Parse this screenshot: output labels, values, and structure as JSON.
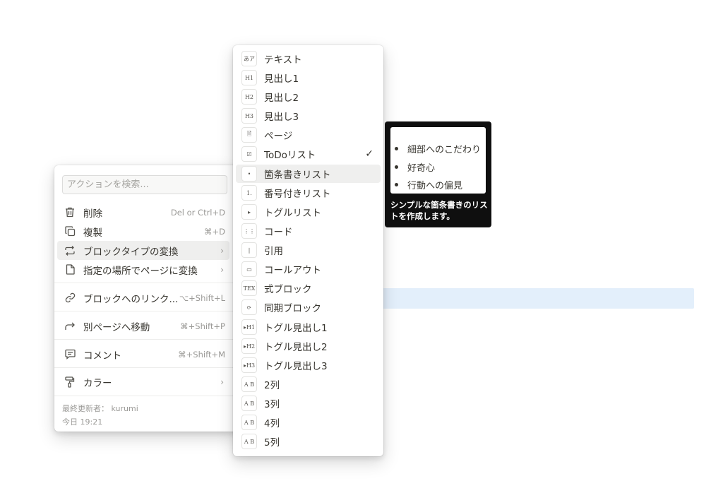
{
  "action_menu": {
    "search_placeholder": "アクションを検索...",
    "items": [
      {
        "label": "削除",
        "shortcut": "Del or Ctrl+D",
        "icon": "trash-icon"
      },
      {
        "label": "複製",
        "shortcut": "⌘+D",
        "icon": "duplicate-icon"
      },
      {
        "label": "ブロックタイプの変換",
        "shortcut": "",
        "icon": "convert-icon",
        "chevron": "›"
      },
      {
        "label": "指定の場所でページに変換",
        "shortcut": "",
        "icon": "page-icon",
        "chevron": "›"
      },
      {
        "label": "ブロックへのリンク...",
        "shortcut": "⌥+Shift+L",
        "icon": "link-icon"
      },
      {
        "label": "別ページへ移動",
        "shortcut": "⌘+Shift+P",
        "icon": "move-arrow-icon"
      },
      {
        "label": "コメント",
        "shortcut": "⌘+Shift+M",
        "icon": "comment-icon"
      },
      {
        "label": "カラー",
        "shortcut": "",
        "icon": "paint-roller-icon",
        "chevron": "›"
      }
    ],
    "last_edited_label": "最終更新者： kurumi",
    "last_edited_time": "今日 19:21"
  },
  "type_menu": {
    "items": [
      {
        "label": "テキスト",
        "thumb": "あア"
      },
      {
        "label": "見出し1",
        "thumb": "H1"
      },
      {
        "label": "見出し2",
        "thumb": "H2"
      },
      {
        "label": "見出し3",
        "thumb": "H3"
      },
      {
        "label": "ページ",
        "thumb": "🗎"
      },
      {
        "label": "ToDoリスト",
        "thumb": "☑",
        "checked": "✓"
      },
      {
        "label": "箇条書きリスト",
        "thumb": "•"
      },
      {
        "label": "番号付きリスト",
        "thumb": "1."
      },
      {
        "label": "トグルリスト",
        "thumb": "▸"
      },
      {
        "label": "コード",
        "thumb": "⋮⋮"
      },
      {
        "label": "引用",
        "thumb": "❘"
      },
      {
        "label": "コールアウト",
        "thumb": "▭"
      },
      {
        "label": "式ブロック",
        "thumb": "TEX"
      },
      {
        "label": "同期ブロック",
        "thumb": "⟳"
      },
      {
        "label": "トグル見出し1",
        "thumb": "▸H1"
      },
      {
        "label": "トグル見出し2",
        "thumb": "▸H2"
      },
      {
        "label": "トグル見出し3",
        "thumb": "▸H3"
      },
      {
        "label": "2列",
        "thumb": "A B"
      },
      {
        "label": "3列",
        "thumb": "A B"
      },
      {
        "label": "4列",
        "thumb": "A B"
      },
      {
        "label": "5列",
        "thumb": "A B"
      }
    ]
  },
  "tooltip": {
    "preview_items": [
      "細部へのこだわり",
      "好奇心",
      "行動への偏見"
    ],
    "description": "シンプルな箇条書きのリストを作成します。"
  }
}
